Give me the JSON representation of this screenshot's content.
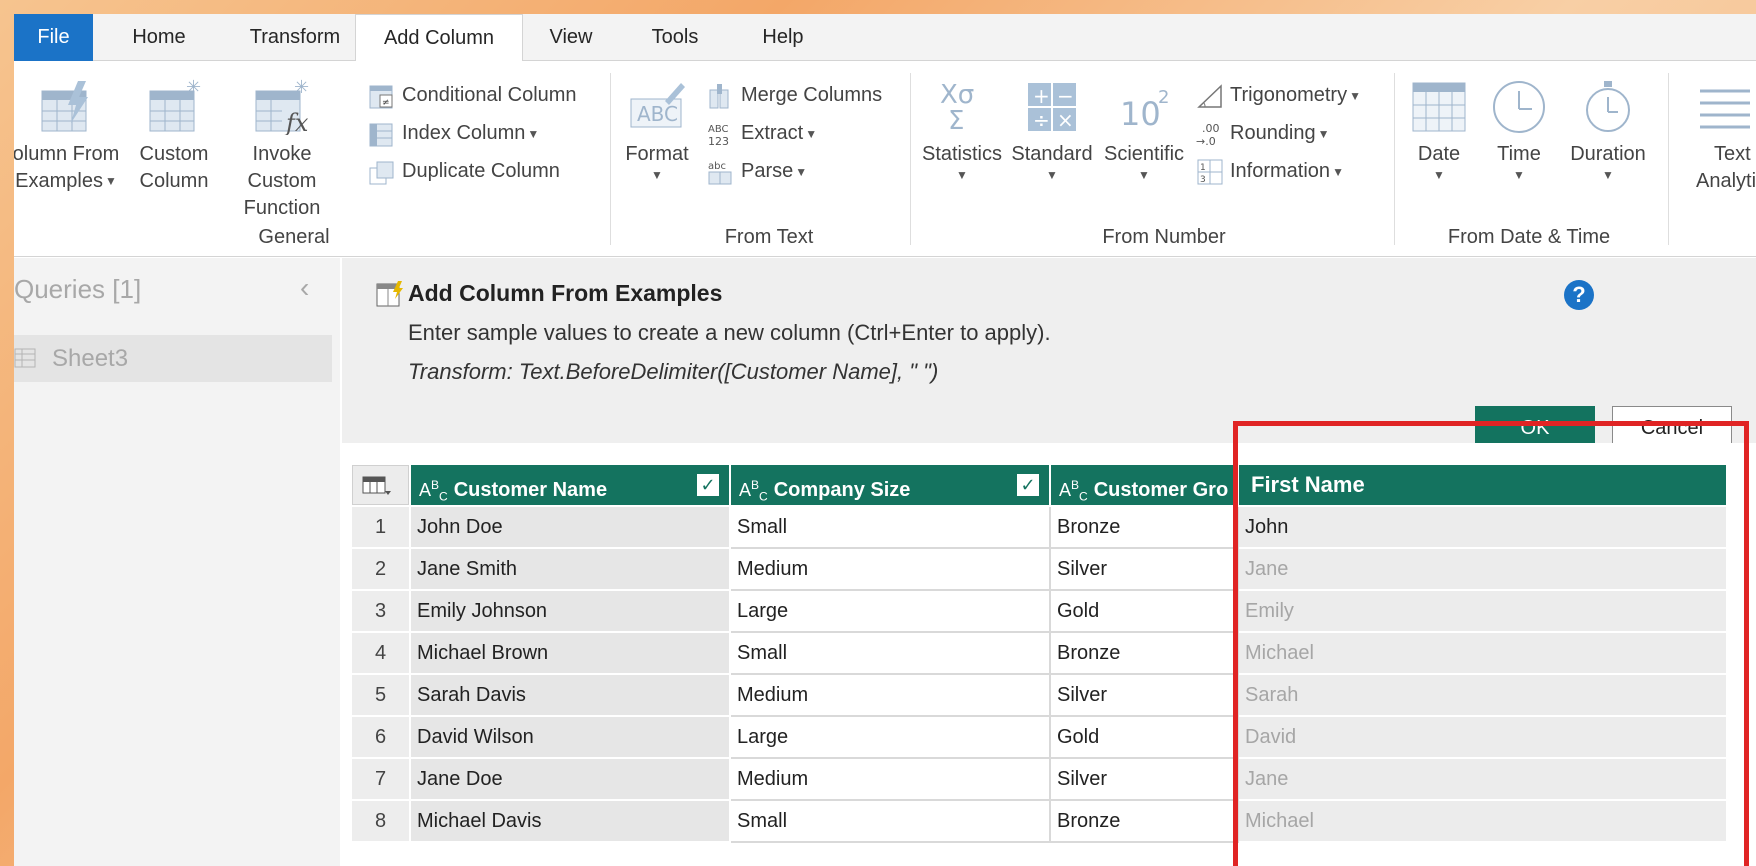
{
  "tabs": [
    "File",
    "Home",
    "Transform",
    "Add Column",
    "View",
    "Tools",
    "Help"
  ],
  "active_tab": "Add Column",
  "ribbon": {
    "general": {
      "label": "General",
      "column_from_examples": [
        "olumn From",
        "Examples"
      ],
      "custom_column": [
        "Custom",
        "Column"
      ],
      "invoke_custom_function": [
        "Invoke Custom",
        "Function"
      ],
      "conditional_column": "Conditional Column",
      "index_column": "Index Column",
      "duplicate_column": "Duplicate Column"
    },
    "from_text": {
      "label": "From Text",
      "format": "Format",
      "merge_columns": "Merge Columns",
      "extract": "Extract",
      "parse": "Parse"
    },
    "from_number": {
      "label": "From Number",
      "statistics": "Statistics",
      "standard": "Standard",
      "scientific": "Scientific",
      "trigonometry": "Trigonometry",
      "rounding": "Rounding",
      "information": "Information"
    },
    "from_date_time": {
      "label": "From Date & Time",
      "date": "Date",
      "time": "Time",
      "duration": "Duration"
    },
    "text_analytics": [
      "Text",
      "Analytic"
    ]
  },
  "queries": {
    "title": "Queries [1]",
    "items": [
      "Sheet3"
    ]
  },
  "banner": {
    "title": "Add Column From Examples",
    "description": "Enter sample values to create a new column (Ctrl+Enter to apply).",
    "transform": "Transform: Text.BeforeDelimiter([Customer Name], \" \")",
    "ok": "OK",
    "cancel": "Cancel",
    "help": "?"
  },
  "table": {
    "columns": [
      "Customer Name",
      "Company Size",
      "Customer Gro",
      "First Name"
    ],
    "type_badge": "ABC",
    "rows": [
      {
        "n": "1",
        "name": "John Doe",
        "size": "Small",
        "group": "Bronze",
        "first": "John"
      },
      {
        "n": "2",
        "name": "Jane Smith",
        "size": "Medium",
        "group": "Silver",
        "first": "Jane"
      },
      {
        "n": "3",
        "name": "Emily Johnson",
        "size": "Large",
        "group": "Gold",
        "first": "Emily"
      },
      {
        "n": "4",
        "name": "Michael Brown",
        "size": "Small",
        "group": "Bronze",
        "first": "Michael"
      },
      {
        "n": "5",
        "name": "Sarah Davis",
        "size": "Medium",
        "group": "Silver",
        "first": "Sarah"
      },
      {
        "n": "6",
        "name": "David Wilson",
        "size": "Large",
        "group": "Gold",
        "first": "David"
      },
      {
        "n": "7",
        "name": "Jane Doe",
        "size": "Medium",
        "group": "Silver",
        "first": "Jane"
      },
      {
        "n": "8",
        "name": "Michael Davis",
        "size": "Small",
        "group": "Bronze",
        "first": "Michael"
      }
    ]
  },
  "colors": {
    "file_tab": "#1b73c7",
    "header_green": "#14735f",
    "highlight": "#e02424"
  }
}
